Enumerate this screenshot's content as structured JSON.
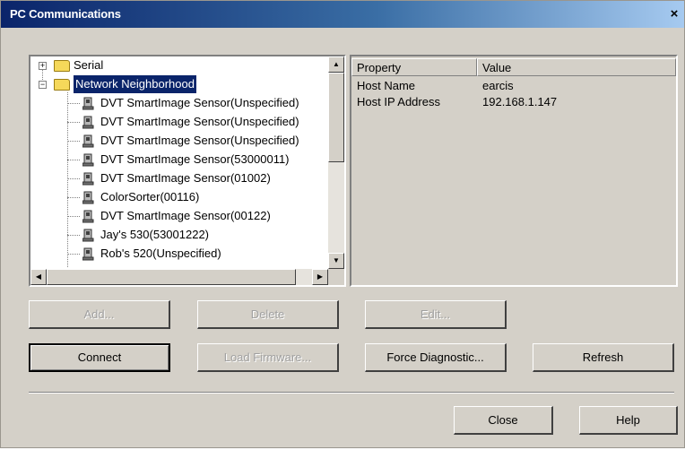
{
  "window": {
    "title": "PC Communications",
    "close_label": "×"
  },
  "tree": {
    "root_items": [
      {
        "label": "Serial",
        "expander": "+"
      },
      {
        "label": "Network Neighborhood",
        "expander": "−"
      }
    ],
    "children": [
      "DVT SmartImage Sensor(Unspecified)",
      "DVT SmartImage Sensor(Unspecified)",
      "DVT SmartImage Sensor(Unspecified)",
      "DVT SmartImage Sensor(53000011)",
      "DVT SmartImage Sensor(01002)",
      "ColorSorter(00116)",
      "DVT SmartImage Sensor(00122)",
      "Jay's 530(53001222)",
      "Rob's 520(Unspecified)"
    ]
  },
  "properties": {
    "columns": [
      "Property",
      "Value"
    ],
    "rows": [
      {
        "property": "Host Name",
        "value": "earcis"
      },
      {
        "property": "Host IP Address",
        "value": "192.168.1.147"
      }
    ]
  },
  "buttons": {
    "add": "Add...",
    "delete": "Delete",
    "edit": "Edit...",
    "connect": "Connect",
    "load_firmware": "Load Firmware...",
    "force_diagnostic": "Force Diagnostic...",
    "refresh": "Refresh",
    "close": "Close",
    "help": "Help"
  }
}
